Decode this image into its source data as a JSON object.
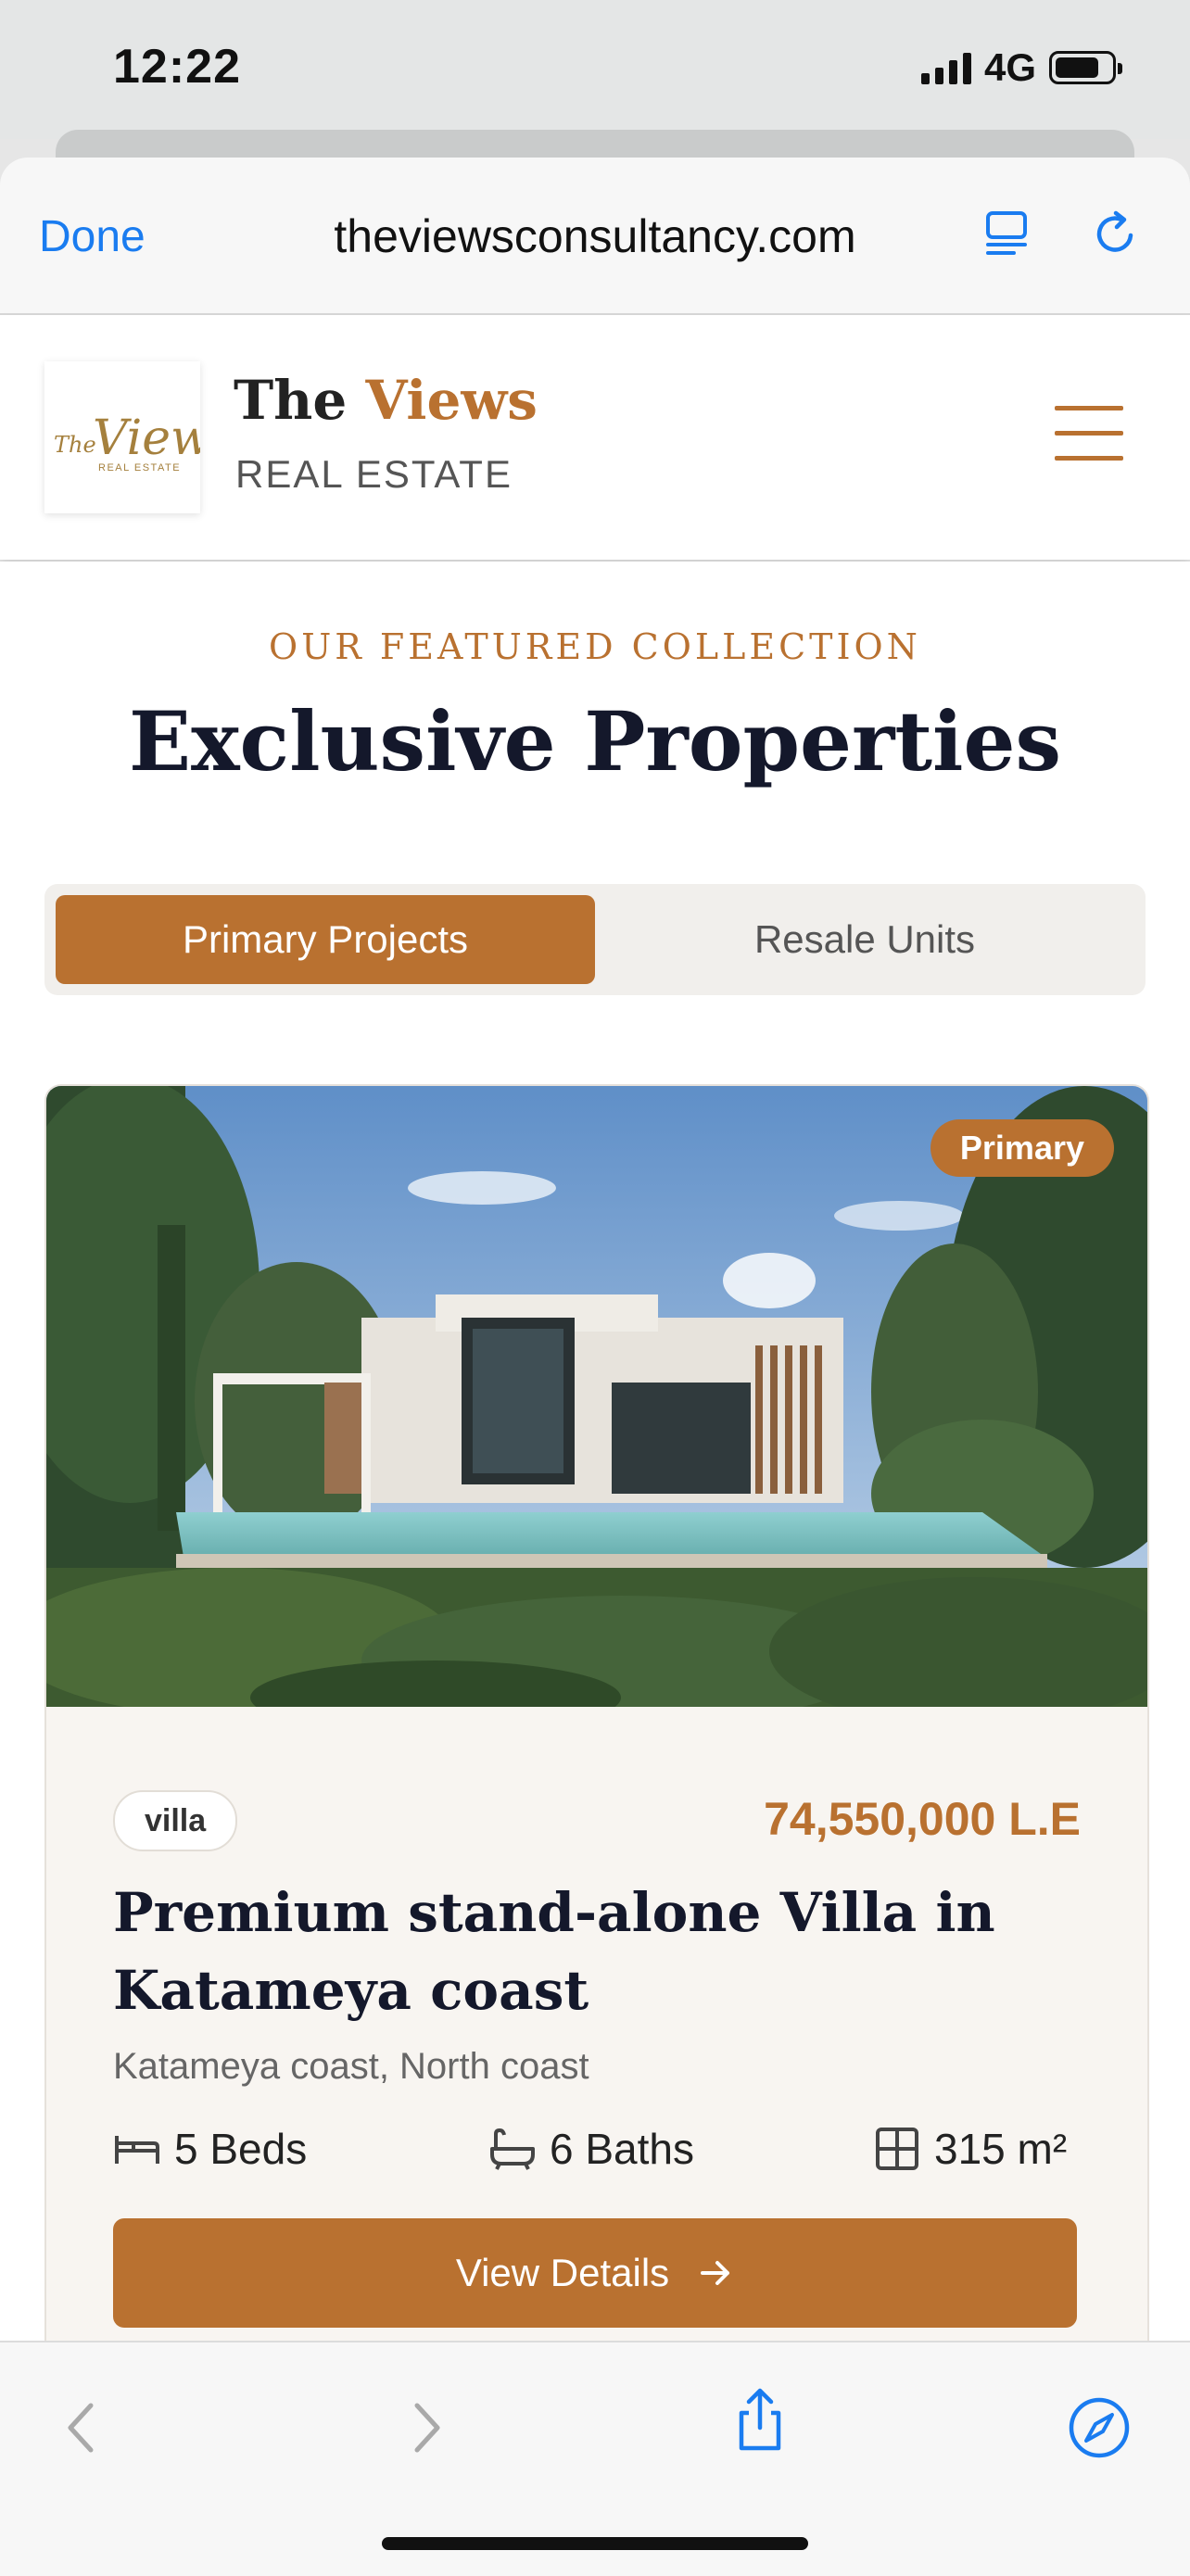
{
  "status": {
    "time": "12:22",
    "network": "4G",
    "battery_level": 0.8
  },
  "browser": {
    "done_label": "Done",
    "url": "theviewsconsultancy.com"
  },
  "site": {
    "brand_first": "The ",
    "brand_accent": "Views",
    "brand_sub": "REAL ESTATE",
    "logo_text": "The Views",
    "logo_sub": "REAL ESTATE"
  },
  "section": {
    "kicker": "OUR FEATURED COLLECTION",
    "title": "Exclusive Properties"
  },
  "tabs": [
    {
      "label": "Primary Projects",
      "active": true
    },
    {
      "label": "Resale Units",
      "active": false
    }
  ],
  "property": {
    "badge": "Primary",
    "type": "villa",
    "price": "74,550,000 L.E",
    "title": "Premium stand-alone Villa in Katameya coast",
    "location": "Katameya coast, North coast",
    "beds": "5 Beds",
    "baths": "6 Baths",
    "area": "315 m²",
    "button_label": "View Details"
  },
  "colors": {
    "accent": "#b97130",
    "ios_blue": "#1a7cf0",
    "title": "#14182b"
  },
  "icons": [
    "back-icon",
    "forward-icon",
    "share-icon",
    "compass-icon",
    "reader-icon",
    "reload-icon",
    "bed-icon",
    "bath-icon",
    "area-icon",
    "arrow-right-icon",
    "menu-icon"
  ]
}
